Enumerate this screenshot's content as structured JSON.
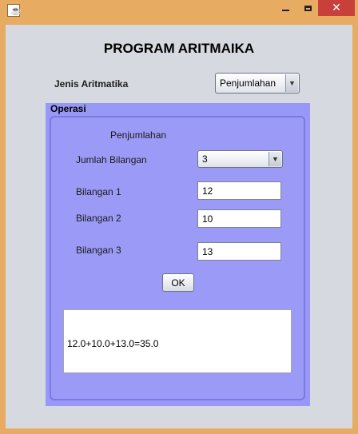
{
  "titlebar": {
    "app_icon": "java-cup-icon",
    "minimize_icon": "minimize-icon",
    "maximize_icon": "maximize-icon",
    "close_glyph": "✕"
  },
  "header": {
    "title": "PROGRAM ARITMAIKA"
  },
  "jenis": {
    "label": "Jenis Aritmatika",
    "selected": "Penjumlahan"
  },
  "operasi": {
    "title": "Operasi",
    "subtitle": "Penjumlahan",
    "jumlah_label": "Jumlah Bilangan",
    "jumlah_selected": "3",
    "fields": [
      {
        "label": "Bilangan 1",
        "value": "12"
      },
      {
        "label": "Bilangan 2",
        "value": "10"
      },
      {
        "label": "Bilangan 3",
        "value": "13"
      }
    ],
    "ok_label": "OK",
    "result": "12.0+10.0+13.0=35.0"
  },
  "colors": {
    "window_frame": "#e8ab62",
    "panel_purple": "#9898f7",
    "close_red": "#c7403a"
  }
}
